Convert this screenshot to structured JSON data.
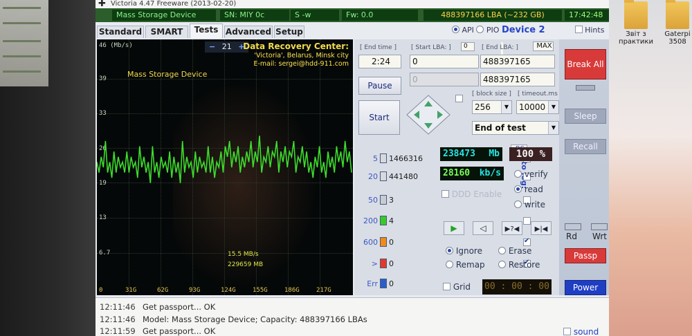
{
  "window": {
    "title": "Victoria 4.47  Freeware (2013-02-20)"
  },
  "infobar": {
    "device": "Mass Storage Device",
    "serial": "SN: MlY 0c",
    "s_field": "S -w",
    "fw": "Fw: 0.0",
    "lba": "488397166 LBA (~232 GB)",
    "clock": "17:42:48"
  },
  "tabs": [
    "Standard",
    "SMART",
    "Tests",
    "Advanced",
    "Setup"
  ],
  "active_tab": "Tests",
  "mode": {
    "api": "API",
    "pio": "PIO",
    "device": "Device 2",
    "hints": "Hints"
  },
  "graph": {
    "y_ticks": [
      "46 (Mb/s)",
      "39",
      "33",
      "26",
      "19",
      "13",
      "6.7"
    ],
    "x_ticks": [
      "0",
      "31G",
      "62G",
      "93G",
      "124G",
      "155G",
      "186G",
      "217G"
    ],
    "zoom_minus": "−",
    "zoom_value": "21",
    "zoom_plus": "+",
    "device_label": "Mass Storage Device",
    "drc_title": "Data Recovery Center:",
    "drc_location": "'Victoria', Belarus, Minsk city",
    "drc_email": "E-mail: sergei@hdd-911.com",
    "speed_readout": "15.5 MB/s",
    "mb_readout": "229659 MB",
    "color_line": "#3ddd2c",
    "color_label": "#f2da4e"
  },
  "chart_data": {
    "type": "line",
    "title": "",
    "xlabel": "",
    "ylabel": "Mb/s",
    "ylim": [
      0,
      46
    ],
    "x_tick_labels": [
      "0",
      "31G",
      "62G",
      "93G",
      "124G",
      "155G",
      "186G",
      "217G"
    ],
    "x_gb_max": 240,
    "series": [
      {
        "values": [
          24,
          22,
          25,
          23,
          28,
          22,
          24,
          21,
          26,
          22,
          25,
          23,
          24,
          22,
          26,
          22,
          25,
          23,
          24,
          21,
          27,
          23,
          25,
          22,
          24,
          20,
          27,
          22,
          24,
          21,
          25,
          23,
          24,
          22,
          26,
          21,
          25,
          22,
          24,
          20,
          28,
          22,
          25,
          23,
          24,
          21,
          26,
          22,
          25,
          23,
          24,
          22,
          27,
          22,
          25,
          21,
          24,
          23,
          26,
          22,
          27,
          25,
          28,
          23,
          26,
          24,
          27,
          22,
          25,
          23,
          26,
          24,
          28,
          23,
          26,
          24,
          29,
          22,
          25,
          24,
          27,
          23,
          26,
          25,
          28,
          22,
          26,
          24,
          27,
          23,
          26,
          25,
          28,
          22,
          25,
          24,
          27,
          23,
          26,
          22,
          24,
          21,
          25,
          23,
          27,
          22,
          24,
          21,
          26,
          23,
          25,
          22,
          27,
          24,
          26,
          23,
          28,
          24,
          26,
          22
        ]
      }
    ]
  },
  "controls": {
    "end_time_label": "[ End time ]",
    "end_time": "2:24",
    "start_lba_label": "[ Start LBA: ]",
    "start_lba_zero": "0",
    "start_lba": "0",
    "start_lba_dim": "0",
    "end_lba_label": "[ End LBA: ]",
    "max_label": "MAX",
    "end_lba": "488397165",
    "end_lba_2": "488397165",
    "pause": "Pause",
    "start": "Start",
    "block_size_label": "[ block size ]",
    "timeout_label": "[ timeout.ms ]",
    "block_size": "256",
    "timeout": "10000",
    "end_action": "End of test"
  },
  "blocks": [
    {
      "ms": "5",
      "count": "1466316",
      "color": "#d6d9df"
    },
    {
      "ms": "20",
      "count": "441480",
      "color": "#d6d9df"
    },
    {
      "ms": "50",
      "count": "3",
      "color": "#c9ccd3"
    },
    {
      "ms": "200",
      "count": "4",
      "color": "#39c92b"
    },
    {
      "ms": "600",
      "count": "0",
      "color": "#f08a1c"
    },
    {
      "ms": ">",
      "count": "0",
      "color": "#e13a2d"
    },
    {
      "ms": "Err",
      "count": "0",
      "color": "#2b5ec8"
    }
  ],
  "rs_label": "RS",
  "to_log_label": "to log:",
  "stats": {
    "mb_value": "238473",
    "mb_unit": "Mb",
    "percent": "100",
    "percent_unit": "%",
    "speed_value": "28160",
    "speed_unit": "kb/s",
    "ddd_enable": "DDD Enable"
  },
  "modes": {
    "verify": "verify",
    "read": "read",
    "write": "write"
  },
  "repair": {
    "ignore": "Ignore",
    "erase": "Erase",
    "remap": "Remap",
    "restore": "Restore",
    "grid": "Grid",
    "timer": "00 : 00 : 00"
  },
  "side": {
    "break_all": "Break All",
    "sleep": "Sleep",
    "recall": "Recall",
    "rd": "Rd",
    "wrt": "Wrt",
    "passp": "Passp",
    "power": "Power",
    "sound": "sound"
  },
  "log": [
    {
      "time": "12:11:46",
      "text": "Get passport... OK"
    },
    {
      "time": "12:11:46",
      "text": "Model: Mass Storage Device; Capacity: 488397166 LBAs"
    },
    {
      "time": "12:11:59",
      "text": "Get passport... OK"
    }
  ],
  "desktop_icons": [
    {
      "label": "Звіт з практики"
    },
    {
      "label": "Gaterpi 3508"
    }
  ]
}
